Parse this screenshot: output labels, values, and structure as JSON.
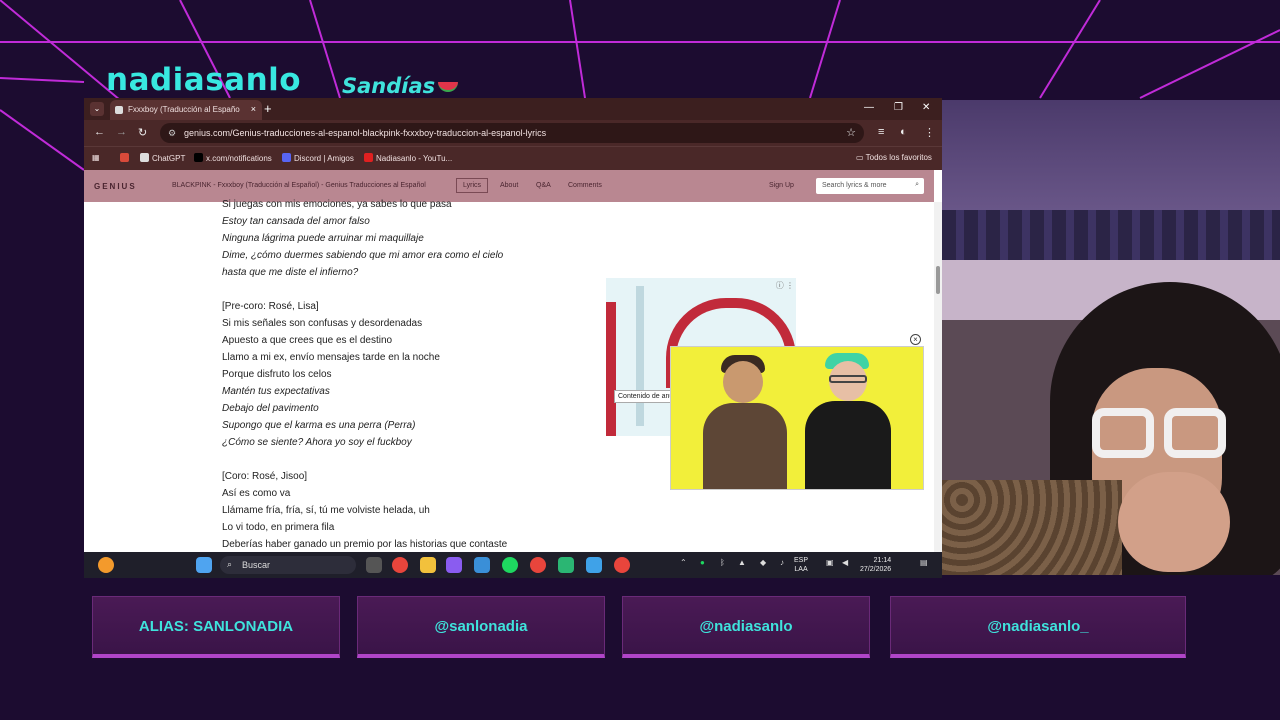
{
  "overlay": {
    "brand": "nadiasanlo",
    "brand2": "Sandías",
    "panels": [
      "ALIAS: SANLONADIA",
      "@sanlonadia",
      "@nadiasanlo",
      "@nadiasanlo_"
    ]
  },
  "browser": {
    "tab_title": "Fxxxboy (Traducción al Españo",
    "url": "genius.com/Genius-traducciones-al-espanol-blackpink-fxxxboy-traduccion-al-espanol-lyrics",
    "bookmarks": [
      "ChatGPT",
      "x.com/notifications",
      "Discord | Amigos",
      "Nadiasanlo - YouTu...",
      "Todos los favoritos"
    ]
  },
  "genius": {
    "logo": "GENIUS",
    "title": "BLACKPINK - Fxxxboy (Traducción al Español) - Genius Traducciones al Español",
    "nav": [
      "Lyrics",
      "About",
      "Q&A",
      "Comments"
    ],
    "signup": "Sign Up",
    "search_placeholder": "Search lyrics & more"
  },
  "lyrics": [
    {
      "t": "Si juegas con mis emociones, ya sabes lo que pasa",
      "i": false
    },
    {
      "t": "Estoy tan cansada del amor falso",
      "i": true
    },
    {
      "t": "Ninguna lágrima puede arruinar mi maquillaje",
      "i": true
    },
    {
      "t": "Dime, ¿cómo duermes sabiendo que mi amor era como el cielo",
      "i": true
    },
    {
      "t": "hasta que me diste el infierno?",
      "i": true
    },
    {
      "t": "",
      "i": false
    },
    {
      "t": "[Pre-coro: Rosé, Lisa]",
      "i": false
    },
    {
      "t": "Si mis señales son confusas y desordenadas",
      "i": false
    },
    {
      "t": "Apuesto a que crees que es el destino",
      "i": false
    },
    {
      "t": "Llamo a mi ex, envío mensajes tarde en la noche",
      "i": false
    },
    {
      "t": "Porque disfruto los celos",
      "i": false
    },
    {
      "t": "Mantén tus expectativas",
      "i": true
    },
    {
      "t": "Debajo del pavimento",
      "i": true
    },
    {
      "t": "Supongo que el karma es una perra (Perra)",
      "i": true
    },
    {
      "t": "¿Cómo se siente? Ahora yo soy el fuckboy",
      "i": true
    },
    {
      "t": "",
      "i": false
    },
    {
      "t": "[Coro: Rosé, Jisoo]",
      "i": false
    },
    {
      "t": "Así es como va",
      "i": false
    },
    {
      "t": "Llámame fría, fría, sí, tú me volviste helada, uh",
      "i": false
    },
    {
      "t": "Lo vi todo, en primera fila",
      "i": false
    },
    {
      "t": "Deberías haber ganado un premio por las historias que contaste",
      "i": false
    }
  ],
  "ad_tooltip": "Contenido de anuncios de terceros",
  "taskbar": {
    "search": "Buscar",
    "lang1": "ESP",
    "lang2": "LAA",
    "time": "21:14",
    "date": "27/2/2026"
  }
}
